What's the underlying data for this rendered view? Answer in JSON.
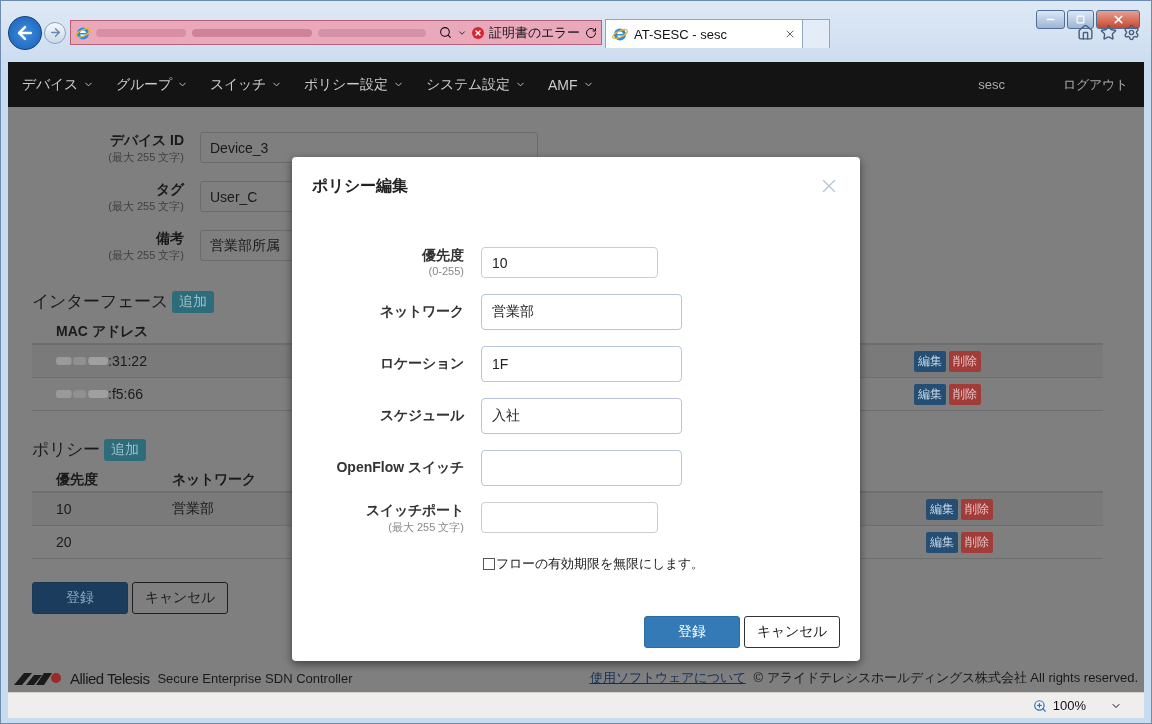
{
  "browser": {
    "address_status": "証明書のエラー",
    "tabs": [
      {
        "title": "AT-SESC - sesc",
        "selected": true
      }
    ]
  },
  "nav": {
    "items": [
      {
        "label": "デバイス"
      },
      {
        "label": "グループ"
      },
      {
        "label": "スイッチ"
      },
      {
        "label": "ポリシー設定"
      },
      {
        "label": "システム設定"
      },
      {
        "label": "AMF"
      }
    ],
    "user": "sesc",
    "logout": "ログアウト"
  },
  "device_form": {
    "fields": [
      {
        "label": "デバイス ID",
        "hint": "(最大 255 文字)",
        "value": "Device_3"
      },
      {
        "label": "タグ",
        "hint": "(最大 255 文字)",
        "value": "User_C"
      },
      {
        "label": "備考",
        "hint": "(最大 255 文字)",
        "value": "営業部所属"
      }
    ]
  },
  "interfaces": {
    "title": "インターフェース",
    "add": "追加",
    "columns": [
      "MAC アドレス"
    ],
    "rows": [
      {
        "cells": [
          ":31:22"
        ],
        "actions": [
          "編集",
          "削除"
        ]
      },
      {
        "cells": [
          ":f5:66"
        ],
        "actions": [
          "編集",
          "削除"
        ]
      }
    ]
  },
  "policies": {
    "title": "ポリシー",
    "add": "追加",
    "columns": [
      "優先度",
      "ネットワーク"
    ],
    "rows": [
      {
        "cells": [
          "10",
          "営業部"
        ],
        "actions": [
          "編集",
          "削除"
        ]
      },
      {
        "cells": [
          "20"
        ],
        "actions": [
          "編集",
          "削除"
        ]
      }
    ]
  },
  "form_buttons": [
    {
      "label": "登録",
      "kind": "primary"
    },
    {
      "label": "キャンセル",
      "kind": "default"
    }
  ],
  "footer": {
    "brand": "Allied Telesis",
    "product": "Secure Enterprise SDN Controller",
    "link": "使用ソフトウェアについて",
    "copyright": "© アライドテレシスホールディングス株式会社 All rights reserved."
  },
  "modal": {
    "title": "ポリシー編集",
    "fields": [
      {
        "label": "優先度",
        "hint": "(0-255)",
        "value": "10",
        "kind": "short"
      },
      {
        "label": "ネットワーク",
        "value": "営業部",
        "kind": "long"
      },
      {
        "label": "ロケーション",
        "value": "1F",
        "kind": "long"
      },
      {
        "label": "スケジュール",
        "value": "入社",
        "kind": "long"
      },
      {
        "label": "OpenFlow スイッチ",
        "kind": "long"
      },
      {
        "label": "スイッチポート",
        "hint": "(最大 255 文字)",
        "kind": "short"
      }
    ],
    "checkbox": {
      "label": "フローの有効期限を無限にします。",
      "checked": false
    },
    "buttons": [
      {
        "label": "登録",
        "kind": "primary"
      },
      {
        "label": "キャンセル",
        "kind": "default"
      }
    ]
  },
  "status_bar": {
    "zoom": "100%"
  }
}
